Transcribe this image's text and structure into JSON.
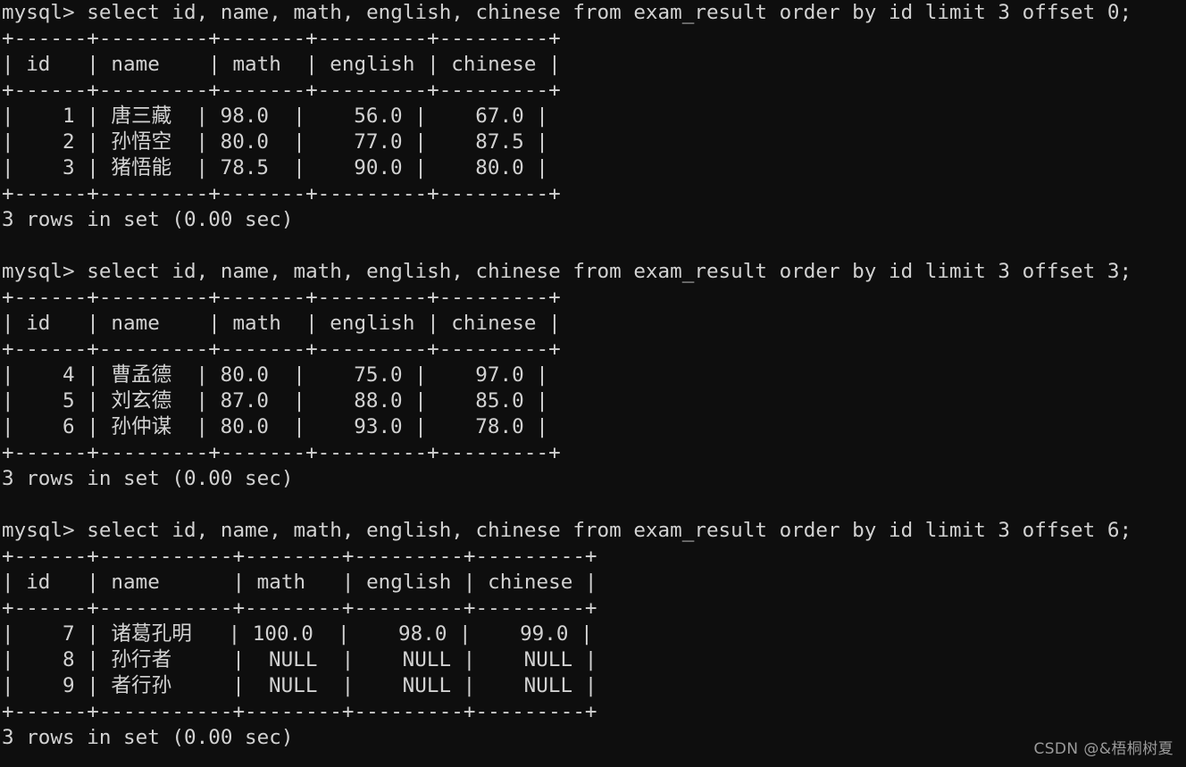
{
  "terminal": {
    "prompt": "mysql> ",
    "background_color": "#0e0e0e",
    "text_color": "#d2d2d2",
    "blocks": [
      {
        "command": "mysql> select id, name, math, english, chinese from exam_result order by id limit 3 offset 0;",
        "separator_top": "+------+---------+-------+---------+---------+",
        "header": "| id   | name    | math  | english | chinese |",
        "separator_mid": "+------+---------+-------+---------+---------+",
        "rows": [
          "|    1 | 唐三藏  | 98.0  |    56.0 |    67.0 |",
          "|    2 | 孙悟空  | 80.0  |    77.0 |    87.5 |",
          "|    3 | 猪悟能  | 78.5  |    90.0 |    80.0 |"
        ],
        "separator_bottom": "+------+---------+-------+---------+---------+",
        "status": "3 rows in set (0.00 sec)"
      },
      {
        "command": "mysql> select id, name, math, english, chinese from exam_result order by id limit 3 offset 3;",
        "separator_top": "+------+---------+-------+---------+---------+",
        "header": "| id   | name    | math  | english | chinese |",
        "separator_mid": "+------+---------+-------+---------+---------+",
        "rows": [
          "|    4 | 曹孟德  | 80.0  |    75.0 |    97.0 |",
          "|    5 | 刘玄德  | 87.0  |    88.0 |    85.0 |",
          "|    6 | 孙仲谋  | 80.0  |    93.0 |    78.0 |"
        ],
        "separator_bottom": "+------+---------+-------+---------+---------+",
        "status": "3 rows in set (0.00 sec)"
      },
      {
        "command": "mysql> select id, name, math, english, chinese from exam_result order by id limit 3 offset 6;",
        "separator_top": "+------+-----------+--------+---------+---------+",
        "header": "| id   | name      | math   | english | chinese |",
        "separator_mid": "+------+-----------+--------+---------+---------+",
        "rows": [
          "|    7 | 诸葛孔明   | 100.0  |    98.0 |    99.0 |",
          "|    8 | 孙行者     |  NULL  |    NULL |    NULL |",
          "|    9 | 者行孙     |  NULL  |    NULL |    NULL |"
        ],
        "separator_bottom": "+------+-----------+--------+---------+---------+",
        "status": "3 rows in set (0.00 sec)"
      }
    ],
    "table_data": {
      "columns": [
        "id",
        "name",
        "math",
        "english",
        "chinese"
      ],
      "queries": [
        {
          "sql": "select id, name, math, english, chinese from exam_result order by id limit 3 offset 0;",
          "limit": 3,
          "offset": 0,
          "row_count": 3,
          "duration": "0.00 sec",
          "records": [
            {
              "id": 1,
              "name": "唐三藏",
              "math": "98.0",
              "english": "56.0",
              "chinese": "67.0"
            },
            {
              "id": 2,
              "name": "孙悟空",
              "math": "80.0",
              "english": "77.0",
              "chinese": "87.5"
            },
            {
              "id": 3,
              "name": "猪悟能",
              "math": "78.5",
              "english": "90.0",
              "chinese": "80.0"
            }
          ]
        },
        {
          "sql": "select id, name, math, english, chinese from exam_result order by id limit 3 offset 3;",
          "limit": 3,
          "offset": 3,
          "row_count": 3,
          "duration": "0.00 sec",
          "records": [
            {
              "id": 4,
              "name": "曹孟德",
              "math": "80.0",
              "english": "75.0",
              "chinese": "97.0"
            },
            {
              "id": 5,
              "name": "刘玄德",
              "math": "87.0",
              "english": "88.0",
              "chinese": "85.0"
            },
            {
              "id": 6,
              "name": "孙仲谋",
              "math": "80.0",
              "english": "93.0",
              "chinese": "78.0"
            }
          ]
        },
        {
          "sql": "select id, name, math, english, chinese from exam_result order by id limit 3 offset 6;",
          "limit": 3,
          "offset": 6,
          "row_count": 3,
          "duration": "0.00 sec",
          "records": [
            {
              "id": 7,
              "name": "诸葛孔明",
              "math": "100.0",
              "english": "98.0",
              "chinese": "99.0"
            },
            {
              "id": 8,
              "name": "孙行者",
              "math": "NULL",
              "english": "NULL",
              "chinese": "NULL"
            },
            {
              "id": 9,
              "name": "者行孙",
              "math": "NULL",
              "english": "NULL",
              "chinese": "NULL"
            }
          ]
        }
      ]
    }
  },
  "watermark": {
    "text": "CSDN @&梧桐树夏"
  }
}
